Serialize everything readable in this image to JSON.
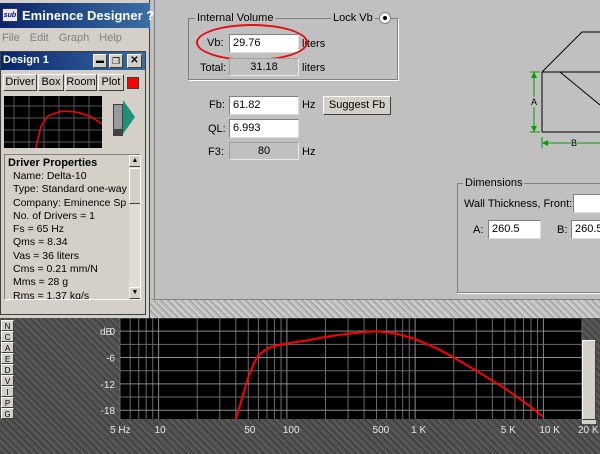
{
  "app": {
    "title": "Eminence Designer ?",
    "menu": [
      "File",
      "Edit",
      "Graph",
      "Help"
    ]
  },
  "design": {
    "title": "Design 1",
    "tabs": [
      "Driver",
      "Box",
      "Room",
      "Plot"
    ],
    "properties_heading": "Driver Properties",
    "properties": [
      "Name: Delta-10",
      "Type: Standard one-way",
      "Company: Eminence Sp",
      "No. of Drivers = 1",
      "Fs = 65 Hz",
      "Qms = 8.34",
      "Vas = 36 liters",
      "Cms = 0.21 mm/N",
      "Mms = 28 g",
      "Rms = 1.37 kg/s"
    ]
  },
  "box": {
    "internal_volume_label": "Internal Volume",
    "lock_label": "Lock Vb",
    "vb_label": "Vb:",
    "vb_value": "29.76",
    "vb_unit": "liters",
    "total_label": "Total:",
    "total_value": "31.18",
    "total_unit": "liters",
    "fb_label": "Fb:",
    "fb_value": "61.82",
    "fb_unit": "Hz",
    "suggest_label": "Suggest Fb",
    "ql_label": "QL:",
    "ql_value": "6.993",
    "f3_label": "F3:",
    "f3_value": "80",
    "f3_unit": "Hz",
    "dimensions_label": "Dimensions",
    "wall_label": "Wall Thickness, Front:",
    "a_label": "A:",
    "a_value": "260.5",
    "b_label": "B:",
    "b_value": "260.5",
    "dim_a": "A",
    "dim_b": "B"
  },
  "side_buttons": [
    "N",
    "C",
    "A",
    "E",
    "D",
    "V",
    "I",
    "P",
    "G"
  ],
  "graph": {
    "db_label": "dB",
    "y_ticks": [
      "0",
      "-6",
      "-12",
      "-18"
    ],
    "x_ticks": [
      "5 Hz",
      "10",
      "50",
      "100",
      "500",
      "1 K",
      "5 K",
      "10 K",
      "20 K"
    ]
  },
  "chart_data": {
    "type": "line",
    "xlabel": "",
    "ylabel": "dB",
    "x_scale": "log",
    "xlim": [
      5,
      20000
    ],
    "ylim": [
      -20,
      3
    ],
    "series": [
      {
        "x": [
          40,
          45,
          50,
          55,
          60,
          70,
          80,
          100,
          150,
          200,
          300,
          400,
          500,
          700,
          1000,
          1500,
          2000,
          3000,
          5000,
          7000,
          10000
        ],
        "y": [
          -20,
          -15,
          -10.5,
          -7.5,
          -5.5,
          -4,
          -3.4,
          -2.8,
          -2,
          -1.3,
          -0.6,
          -0.2,
          0,
          -0.5,
          -1.8,
          -4,
          -6,
          -9,
          -13,
          -16,
          -19.5
        ]
      }
    ],
    "colors": {
      "line": "#ff0000",
      "grid": "#6a6a6a",
      "background": "#000000"
    }
  },
  "colors": {
    "selection_ellipse": "#e01010",
    "swatch": "#ff0000",
    "titlebar": "#0a246a"
  }
}
